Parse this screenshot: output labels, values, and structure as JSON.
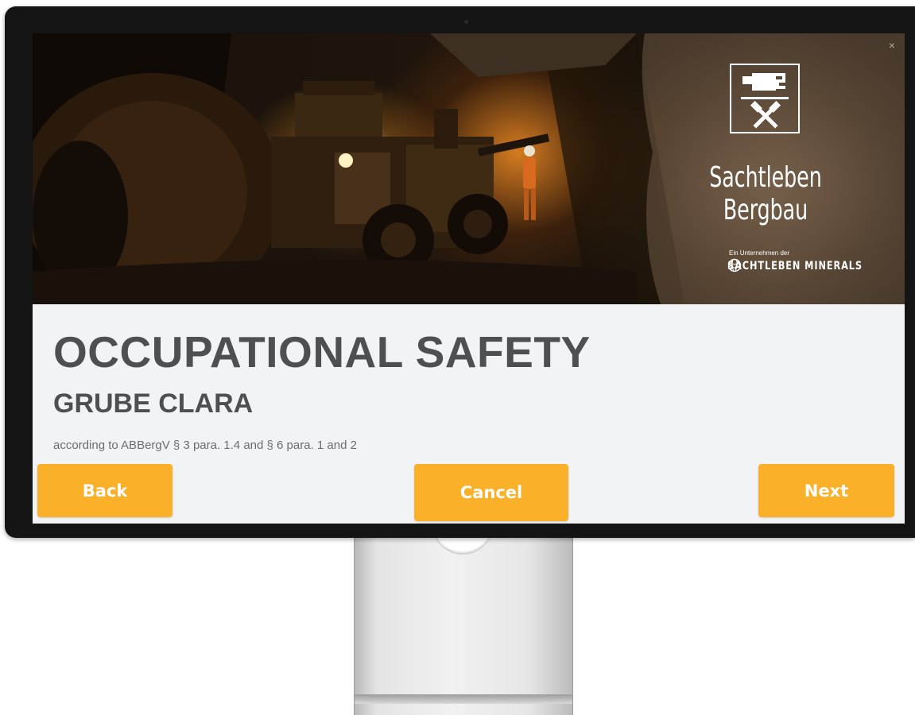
{
  "hero": {
    "close_label": "×",
    "brand": {
      "name": "Sachtleben Bergbau",
      "parent_intro": "Ein Unternehmen der",
      "parent_name": "SACHTLEBEN MINERALS"
    }
  },
  "content": {
    "title": "OCCUPATIONAL SAFETY",
    "subtitle": "GRUBE CLARA",
    "legal_note": "according to ABBergV § 3 para. 1.4 and § 6 para. 1 and 2"
  },
  "buttons": {
    "back": "Back",
    "cancel": "Cancel",
    "next": "Next"
  },
  "colors": {
    "accent": "#fbb02a",
    "heading": "#4d4f51",
    "panel_background": "#f2f3f5",
    "bezel": "#141414"
  },
  "icons": {
    "logo": "mining-hammer-and-pick-icon",
    "parent_logo": "globe-icon"
  }
}
